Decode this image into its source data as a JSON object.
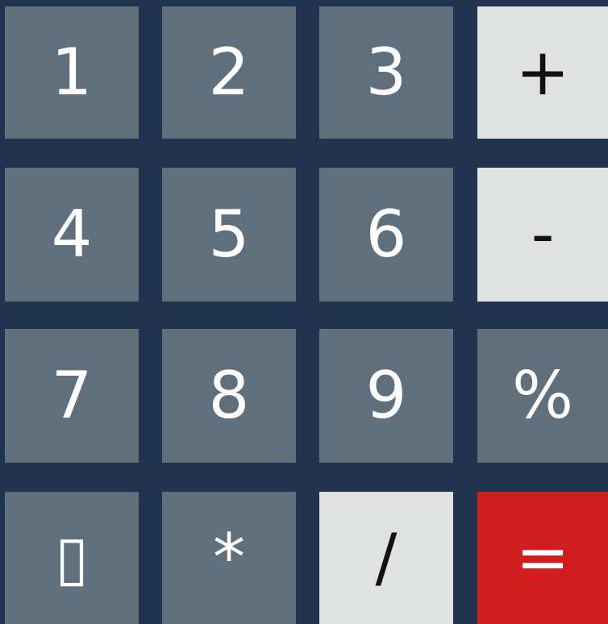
{
  "keypad": {
    "rows": [
      [
        {
          "label": "1",
          "name": "key-1"
        },
        {
          "label": "2",
          "name": "key-2"
        },
        {
          "label": "3",
          "name": "key-3"
        },
        {
          "label": "+",
          "name": "key-plus"
        }
      ],
      [
        {
          "label": "4",
          "name": "key-4"
        },
        {
          "label": "5",
          "name": "key-5"
        },
        {
          "label": "6",
          "name": "key-6"
        },
        {
          "label": "-",
          "name": "key-minus"
        }
      ],
      [
        {
          "label": "7",
          "name": "key-7"
        },
        {
          "label": "8",
          "name": "key-8"
        },
        {
          "label": "9",
          "name": "key-9"
        },
        {
          "label": "%",
          "name": "key-percent"
        }
      ],
      [
        {
          "label": "▯",
          "name": "key-unknown-glyph"
        },
        {
          "label": "*",
          "name": "key-multiply"
        },
        {
          "label": "/",
          "name": "key-divide"
        },
        {
          "label": "=",
          "name": "key-equals"
        }
      ]
    ]
  },
  "colors": {
    "background": "#21344f",
    "key_dark": "#5f6f7b",
    "key_light": "#e0e2e1",
    "key_equals": "#d11d1d"
  }
}
